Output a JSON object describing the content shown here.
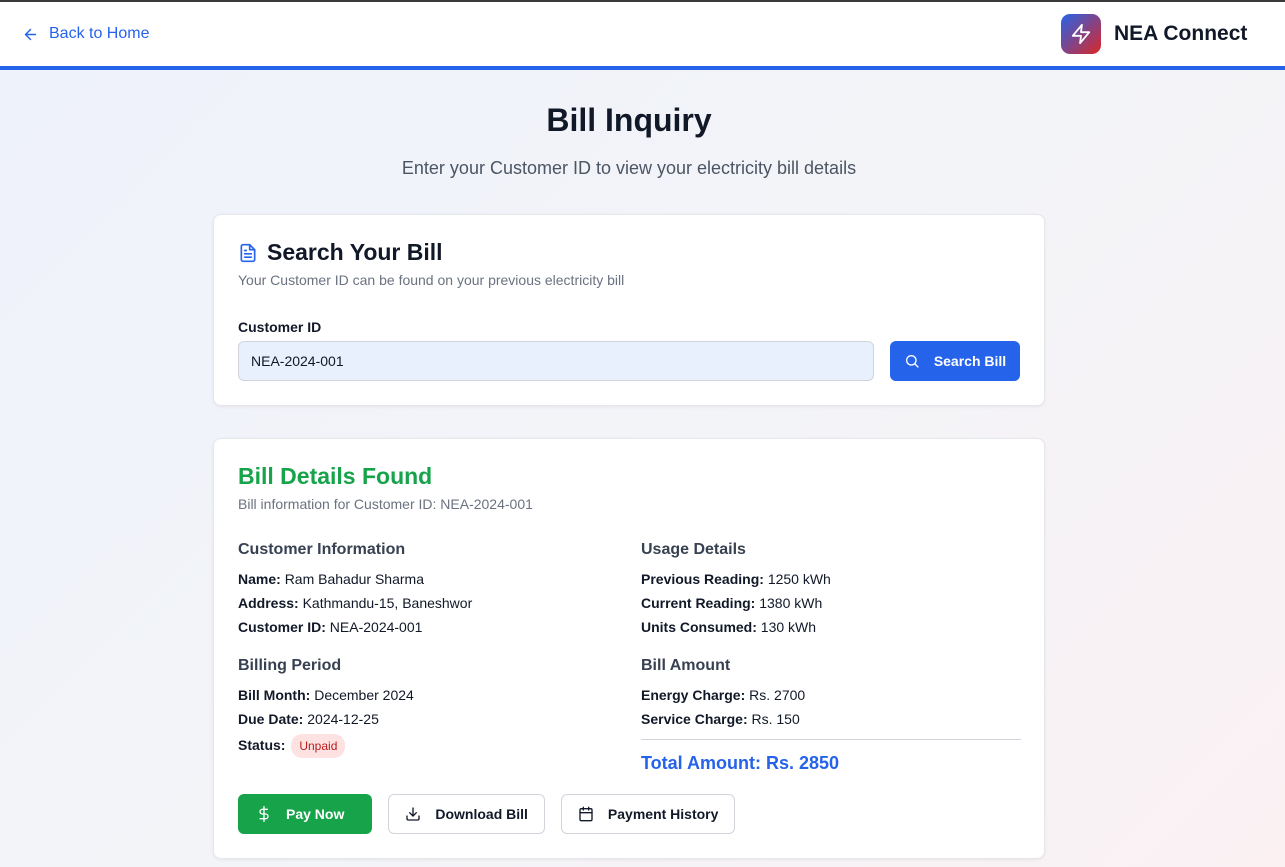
{
  "header": {
    "back_label": "Back to Home",
    "brand_name": "NEA Connect"
  },
  "page": {
    "title": "Bill Inquiry",
    "subtitle": "Enter your Customer ID to view your electricity bill details"
  },
  "search_card": {
    "title": "Search Your Bill",
    "description": "Your Customer ID can be found on your previous electricity bill",
    "field_label": "Customer ID",
    "field_value": "NEA-2024-001",
    "button_label": "Search Bill"
  },
  "results": {
    "title": "Bill Details Found",
    "description": "Bill information for Customer ID: NEA-2024-001",
    "customer_info": {
      "heading": "Customer Information",
      "name_label": "Name:",
      "name": "Ram Bahadur Sharma",
      "address_label": "Address:",
      "address": "Kathmandu-15, Baneshwor",
      "id_label": "Customer ID:",
      "id": "NEA-2024-001"
    },
    "usage": {
      "heading": "Usage Details",
      "previous_label": "Previous Reading:",
      "previous": "1250 kWh",
      "current_label": "Current Reading:",
      "current": "1380 kWh",
      "units_label": "Units Consumed:",
      "units": "130 kWh"
    },
    "billing_period": {
      "heading": "Billing Period",
      "month_label": "Bill Month:",
      "month": "December 2024",
      "due_label": "Due Date:",
      "due": "2024-12-25",
      "status_label": "Status:",
      "status": "Unpaid"
    },
    "amount": {
      "heading": "Bill Amount",
      "energy_label": "Energy Charge:",
      "energy": "Rs. 2700",
      "service_label": "Service Charge:",
      "service": "Rs. 150",
      "total": "Total Amount: Rs. 2850"
    },
    "actions": {
      "pay": "Pay Now",
      "download": "Download Bill",
      "history": "Payment History"
    }
  },
  "colors": {
    "accent": "#2563eb",
    "success": "#16a34a",
    "danger": "#dc2626"
  },
  "icons": [
    "arrow-left-icon",
    "zap-icon",
    "file-text-icon",
    "search-icon",
    "dollar-icon",
    "download-icon",
    "calendar-icon"
  ]
}
